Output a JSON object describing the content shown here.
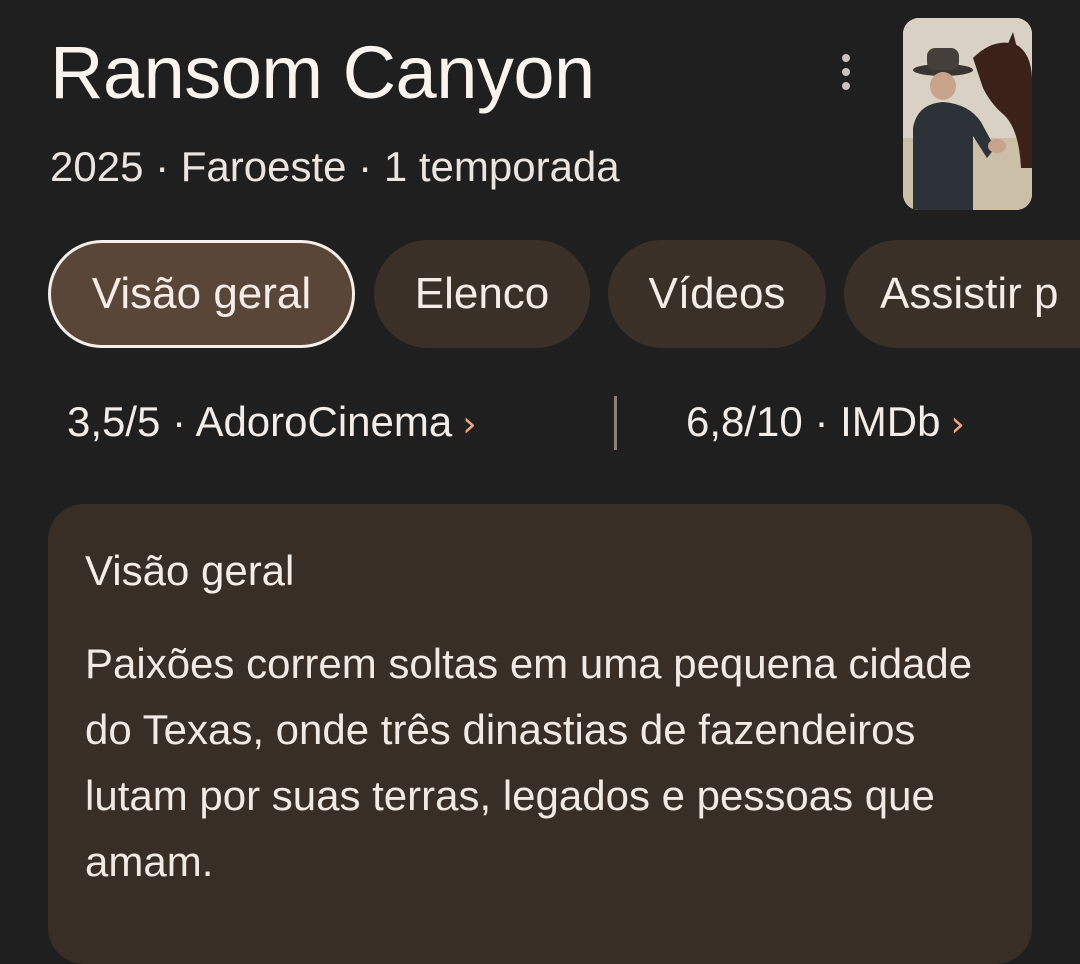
{
  "header": {
    "title": "Ransom Canyon",
    "meta": "2025 · Faroeste · 1 temporada",
    "menu_icon": "more-vert-icon",
    "poster_icon": "show-poster-image"
  },
  "tabs": [
    {
      "label": "Visão geral",
      "active": true
    },
    {
      "label": "Elenco",
      "active": false
    },
    {
      "label": "Vídeos",
      "active": false
    },
    {
      "label": "Assistir p",
      "active": false
    }
  ],
  "ratings": [
    {
      "score": "3,5/5",
      "source": "AdoroCinema",
      "chevron": "›"
    },
    {
      "score": "6,8/10",
      "source": "IMDb",
      "chevron": "›"
    }
  ],
  "overview": {
    "heading": "Visão geral",
    "text": "Paixões correm soltas em uma pequena cidade do Texas, onde três dinastias de fazendeiros lutam por suas terras, legados e pessoas que amam."
  },
  "colors": {
    "background": "#1f1f1f",
    "chip": "#3a3028",
    "chip_active": "#5a4638",
    "card": "#382e26",
    "chevron": "#f0a77c"
  }
}
